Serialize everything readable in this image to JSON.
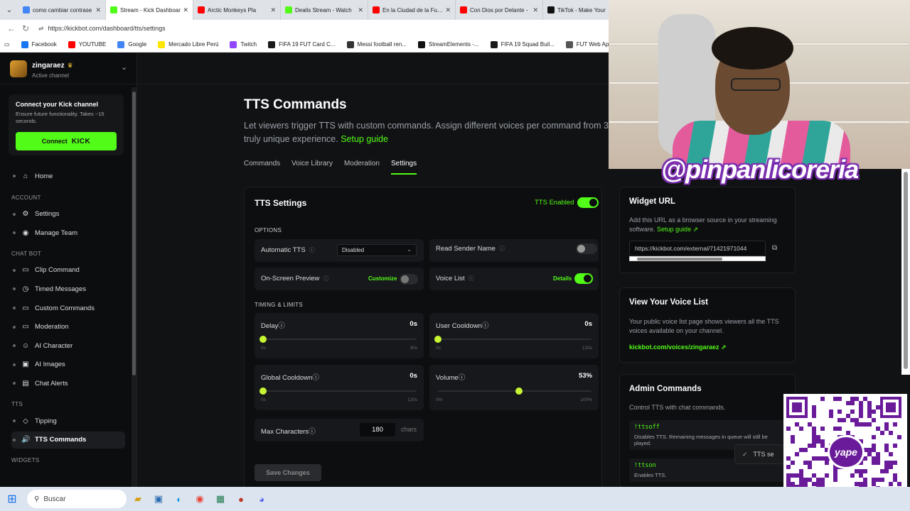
{
  "browser": {
    "tabs": [
      {
        "title": "como cambiar contrase",
        "color": "#4285f4",
        "active": false
      },
      {
        "title": "Stream - Kick Dashboar",
        "color": "#53fc18",
        "active": true
      },
      {
        "title": "Arctic Monkeys Pla",
        "color": "#ff0000",
        "active": false
      },
      {
        "title": "Dealis Stream - Watch",
        "color": "#53fc18",
        "active": false
      },
      {
        "title": "En la Ciudad de la Furia",
        "color": "#ff0000",
        "active": false
      },
      {
        "title": "Con Dios por Delante -",
        "color": "#ff0000",
        "active": false
      },
      {
        "title": "TikTok - Make Your",
        "color": "#111111",
        "active": false
      }
    ],
    "url": "https://kickbot.com/dashboard/tts/settings",
    "bookmarks": [
      {
        "label": "Facebook",
        "color": "#1877f2"
      },
      {
        "label": "YOUTUBE",
        "color": "#ff0000"
      },
      {
        "label": "Google",
        "color": "#4285f4"
      },
      {
        "label": "Mercado Libre Perú",
        "color": "#ffe600"
      },
      {
        "label": "Twitch",
        "color": "#9146ff"
      },
      {
        "label": "FIFA 19 FUT Card C...",
        "color": "#1a1a1a"
      },
      {
        "label": "Messi football ren...",
        "color": "#333333"
      },
      {
        "label": "StreamElements -...",
        "color": "#111111"
      },
      {
        "label": "FIFA 19 Squad Buil...",
        "color": "#1a1a1a"
      },
      {
        "label": "FUT Web App - EA...",
        "color": "#555555"
      }
    ]
  },
  "sidebar": {
    "channel_name": "zingaraez",
    "channel_status": "Active channel",
    "connect": {
      "heading": "Connect your Kick channel",
      "text": "Ensure future functionality. Takes ~15 seconds.",
      "button_label": "Connect",
      "button_brand": "KICK"
    },
    "home": "Home",
    "sections": [
      {
        "heading": "ACCOUNT",
        "items": [
          {
            "label": "Settings",
            "icon": "⚙"
          },
          {
            "label": "Manage Team",
            "icon": "◉"
          }
        ]
      },
      {
        "heading": "CHAT BOT",
        "items": [
          {
            "label": "Clip Command",
            "icon": "▭"
          },
          {
            "label": "Timed Messages",
            "icon": "◷"
          },
          {
            "label": "Custom Commands",
            "icon": "▭"
          },
          {
            "label": "Moderation",
            "icon": "▭"
          },
          {
            "label": "AI Character",
            "icon": "☺"
          },
          {
            "label": "AI Images",
            "icon": "▣"
          },
          {
            "label": "Chat Alerts",
            "icon": "▤"
          }
        ]
      },
      {
        "heading": "TTS",
        "items": [
          {
            "label": "Tipping",
            "icon": "◇"
          },
          {
            "label": "TTS Commands",
            "icon": "🔊",
            "active": true
          }
        ]
      },
      {
        "heading": "WIDGETS",
        "items": []
      }
    ]
  },
  "main": {
    "title": "TTS Commands",
    "description": "Let viewers trigger TTS with custom commands. Assign different voices per command from 3",
    "description_line2": "truly unique experience.",
    "setup_link": "Setup guide",
    "tabs": [
      "Commands",
      "Voice Library",
      "Moderation",
      "Settings"
    ],
    "active_tab": "Settings",
    "settings": {
      "title": "TTS Settings",
      "enabled_label": "TTS Enabled",
      "options_heading": "OPTIONS",
      "automatic_tts_label": "Automatic TTS",
      "automatic_tts_value": "Disabled",
      "read_sender_label": "Read Sender Name",
      "onscreen_label": "On-Screen Preview",
      "customize_label": "Customize",
      "voice_list_label": "Voice List",
      "details_label": "Details",
      "timing_heading": "TIMING & LIMITS",
      "sliders": [
        {
          "label": "Delay",
          "value_text": "0s",
          "min": "0s",
          "max": "30s",
          "fraction": 0.0
        },
        {
          "label": "User Cooldown",
          "value_text": "0s",
          "min": "0s",
          "max": "120s",
          "fraction": 0.0
        },
        {
          "label": "Global Cooldown",
          "value_text": "0s",
          "min": "0s",
          "max": "120s",
          "fraction": 0.0
        },
        {
          "label": "Volume",
          "value_text": "53%",
          "min": "0%",
          "max": "100%",
          "fraction": 0.53
        }
      ],
      "max_chars_label": "Max Characters",
      "max_chars_value": "180",
      "max_chars_unit": "chars",
      "save_label": "Save Changes"
    },
    "widget": {
      "title": "Widget URL",
      "text": "Add this URL as a browser source in your streaming software.",
      "setup_link": "Setup guide",
      "url": "https://kickbot.com/external/71421971044"
    },
    "voice_list": {
      "title": "View Your Voice List",
      "text": "Your public voice list page shows viewers all the TTS voices available on your channel.",
      "link": "kickbot.com/voices/zingaraez"
    },
    "admin": {
      "title": "Admin Commands",
      "text": "Control TTS with chat commands.",
      "commands": [
        {
          "cmd": "!ttsoff",
          "desc": "Disables TTS. Remaining messages in queue will still be played."
        },
        {
          "cmd": "!ttson",
          "desc": "Enables TTS."
        }
      ]
    },
    "toast": "TTS se"
  },
  "overlay": {
    "handle": "@pinpanlicoreria",
    "qr_brand": "yape"
  },
  "taskbar": {
    "search_placeholder": "Buscar"
  }
}
